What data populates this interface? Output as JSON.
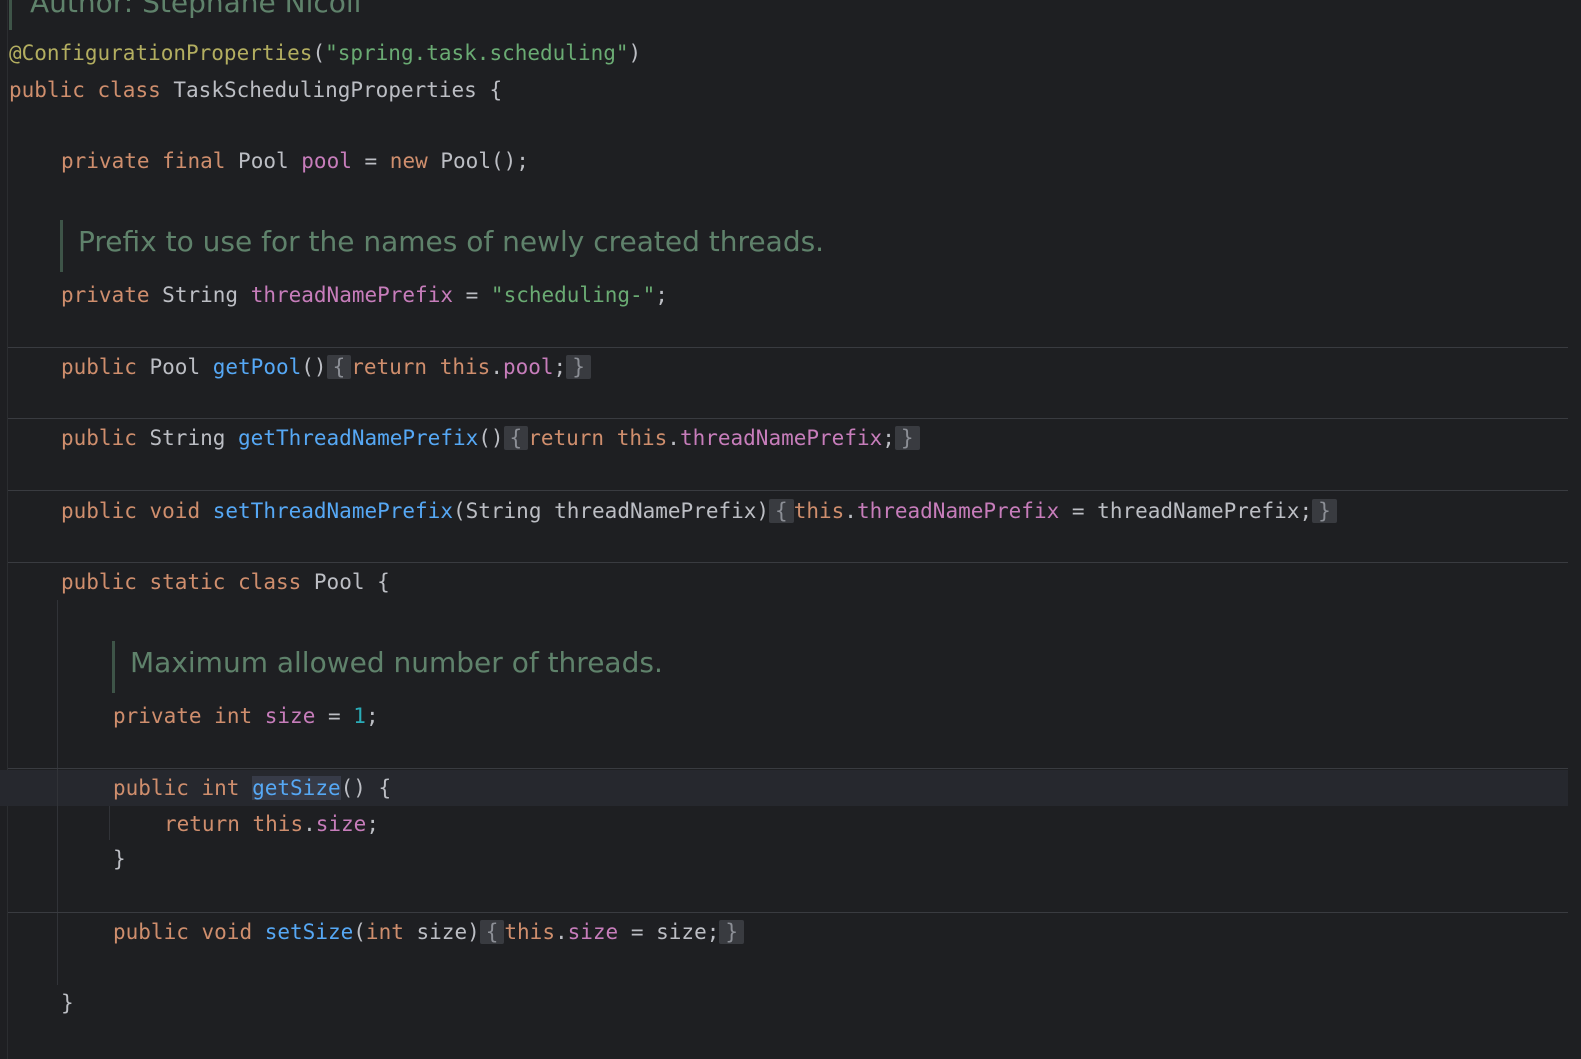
{
  "javadoc": {
    "author": "Author: Stephane Nicoll",
    "prefix_doc": "Prefix to use for the names of newly created threads.",
    "size_doc": "Maximum allowed number of threads."
  },
  "code": {
    "annotation": "@ConfigurationProperties",
    "annotation_args_open": "(",
    "annotation_value": "\"spring.task.scheduling\"",
    "annotation_args_close": ")",
    "class_name": "TaskSchedulingProperties",
    "pool_type": "Pool",
    "pool_field": "pool",
    "pool_ctor": "Pool();",
    "prefix_type": "String",
    "prefix_field": "threadNamePrefix",
    "prefix_value": "\"scheduling-\"",
    "get_pool": "getPool",
    "get_prefix": "getThreadNamePrefix",
    "set_prefix": "setThreadNamePrefix",
    "set_prefix_param": "(String threadNamePrefix)",
    "set_prefix_rhs": "threadNamePrefix;",
    "inner_class": "Pool",
    "size_field": "size",
    "size_value": "1",
    "get_size": "getSize",
    "set_size": "setSize",
    "set_size_param_type": "int",
    "set_size_param_name": "size)",
    "set_size_rhs": "size;"
  },
  "keywords": {
    "public": "public",
    "private": "private",
    "final": "final",
    "class": "class",
    "new": "new",
    "return": "return",
    "this": "this",
    "void": "void",
    "static": "static",
    "int": "int"
  }
}
